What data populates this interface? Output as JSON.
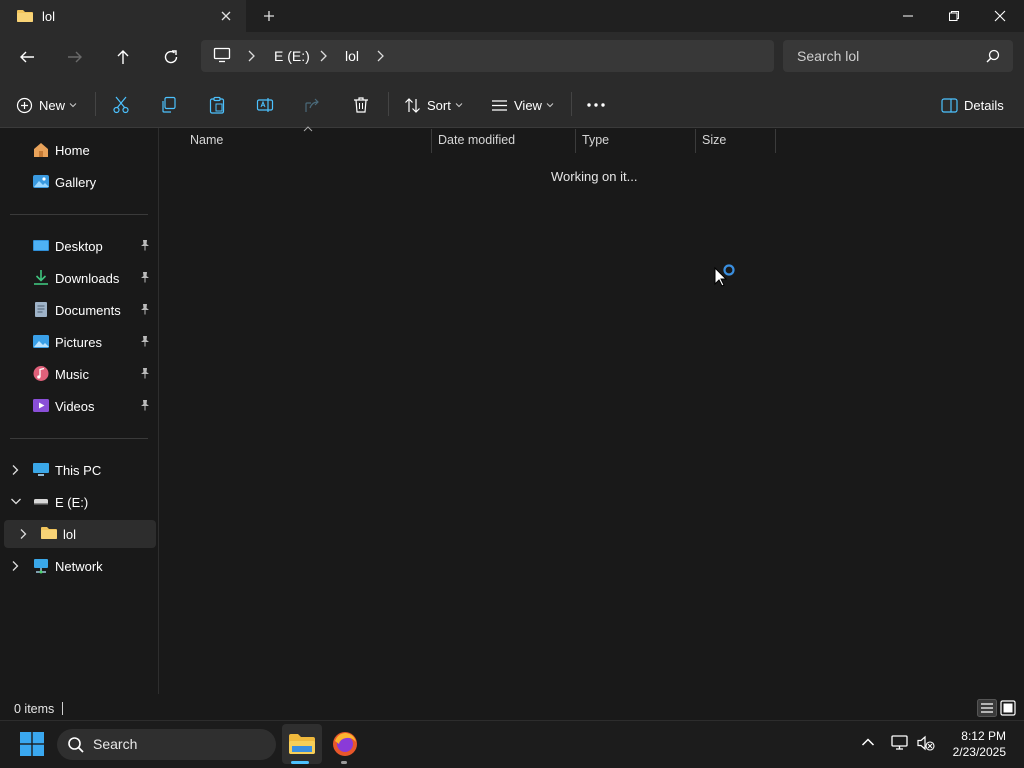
{
  "window": {
    "tab_title": "lol"
  },
  "navigation": {
    "breadcrumbs": [
      "E (E:)",
      "lol"
    ],
    "search_placeholder": "Search lol"
  },
  "commands": {
    "new_label": "New",
    "sort_label": "Sort",
    "view_label": "View",
    "details_label": "Details"
  },
  "sidebar": {
    "home": "Home",
    "gallery": "Gallery",
    "quick_access": [
      "Desktop",
      "Downloads",
      "Documents",
      "Pictures",
      "Music",
      "Videos"
    ],
    "this_pc": "This PC",
    "drive": "E (E:)",
    "folder": "lol",
    "network": "Network"
  },
  "columns": [
    "Name",
    "Date modified",
    "Type",
    "Size"
  ],
  "content": {
    "loading_text": "Working on it..."
  },
  "status": {
    "item_count": "0 items"
  },
  "taskbar": {
    "search_label": "Search",
    "time": "8:12 PM",
    "date": "2/23/2025"
  },
  "colors": {
    "accent": "#4cc2ff",
    "folder": "#f2c55c",
    "background": "#191919",
    "toolbar": "#2b2b2b"
  },
  "icons": [
    "folder-icon",
    "close-icon",
    "plus-icon",
    "minimize-icon",
    "restore-icon",
    "back-arrow-icon",
    "forward-arrow-icon",
    "up-arrow-icon",
    "refresh-icon",
    "monitor-icon",
    "search-icon",
    "cut-icon",
    "copy-icon",
    "paste-icon",
    "rename-icon",
    "share-icon",
    "delete-icon",
    "sort-icon",
    "view-icon",
    "more-icon",
    "details-pane-icon",
    "home-icon",
    "gallery-icon",
    "desktop-icon",
    "download-icon",
    "document-icon",
    "pictures-icon",
    "music-icon",
    "videos-icon",
    "pin-icon",
    "pc-icon",
    "drive-icon",
    "network-icon",
    "windows-logo-icon",
    "file-explorer-icon",
    "firefox-icon",
    "chevron-up-icon",
    "network-status-icon",
    "volume-muted-icon",
    "busy-cursor-icon"
  ]
}
